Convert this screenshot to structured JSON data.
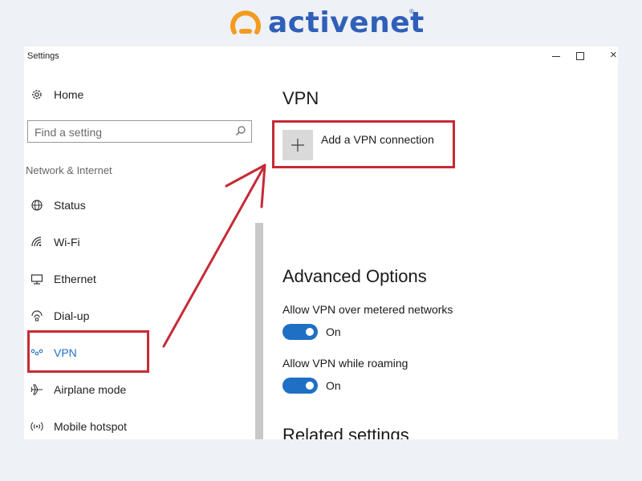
{
  "brand": {
    "name": "activenet",
    "reg_mark": "®",
    "mark_color": "#f39b1f",
    "text_color": "#2f5fb8"
  },
  "window": {
    "title": "Settings",
    "controls": {
      "minimize_icon": "minimize-icon",
      "maximize_icon": "maximize-icon",
      "close_icon": "close-icon"
    }
  },
  "sidebar": {
    "home": {
      "label": "Home",
      "icon": "gear-icon"
    },
    "search": {
      "placeholder": "Find a setting",
      "icon": "search-icon"
    },
    "section": "Network & Internet",
    "items": [
      {
        "label": "Status",
        "icon": "globe-icon"
      },
      {
        "label": "Wi-Fi",
        "icon": "wifi-icon"
      },
      {
        "label": "Ethernet",
        "icon": "ethernet-icon"
      },
      {
        "label": "Dial-up",
        "icon": "dialup-icon"
      },
      {
        "label": "VPN",
        "icon": "vpn-icon",
        "active": true
      },
      {
        "label": "Airplane mode",
        "icon": "airplane-icon"
      },
      {
        "label": "Mobile hotspot",
        "icon": "hotspot-icon"
      }
    ]
  },
  "main": {
    "title": "VPN",
    "add_vpn": {
      "label": "Add a VPN connection",
      "icon": "plus-icon"
    },
    "advanced": {
      "title": "Advanced Options",
      "options": [
        {
          "label": "Allow VPN over metered networks",
          "state": "On"
        },
        {
          "label": "Allow VPN while roaming",
          "state": "On"
        }
      ]
    },
    "related": {
      "title": "Related settings"
    }
  },
  "colors": {
    "accent": "#1f6fc5",
    "annotation": "#c62a36"
  }
}
